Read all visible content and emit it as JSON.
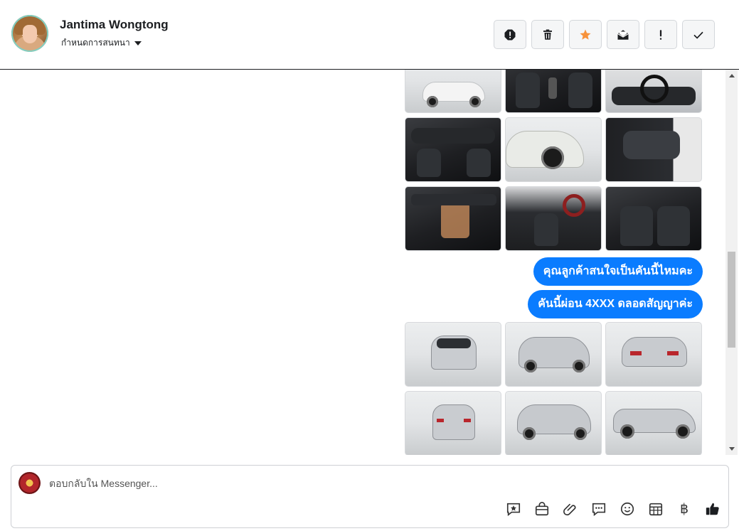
{
  "header": {
    "name": "Jantima Wongtong",
    "subtitle": "กำหนดการสนทนา",
    "actions": [
      {
        "name": "report-button",
        "icon": "alert-octagon-icon"
      },
      {
        "name": "delete-button",
        "icon": "trash-icon"
      },
      {
        "name": "star-button",
        "icon": "star-icon",
        "color": "#f7923b"
      },
      {
        "name": "mark-unread-button",
        "icon": "open-envelope-icon"
      },
      {
        "name": "important-button",
        "icon": "exclamation-icon"
      },
      {
        "name": "done-button",
        "icon": "check-icon"
      }
    ]
  },
  "chat": {
    "messages": [
      {
        "type": "images",
        "tiles": [
          "car-side-white",
          "interior-gear",
          "interior-wheel",
          "interior-dash",
          "car-front-white",
          "door-panel",
          "dashboard-console",
          "front-seats",
          "rear-seats"
        ]
      },
      {
        "type": "text",
        "text": "คุณลูกค้าสนใจเป็นคันนี้ไหมคะ"
      },
      {
        "type": "text",
        "text": "คันนี้ผ่อน 4XXX  ดลอดสัญญาค่ะ"
      },
      {
        "type": "images",
        "tiles": [
          "silver-front",
          "silver-front-34",
          "silver-rear-34",
          "silver-rear",
          "silver-rear-left",
          "silver-side"
        ]
      }
    ],
    "accent": "#0a7cff"
  },
  "composer": {
    "placeholder": "ตอบกลับใน Messenger...",
    "tools": [
      "saved-reply-icon",
      "shop-bag-icon",
      "paperclip-icon",
      "chat-bubble-icon",
      "emoji-icon",
      "table-icon",
      "baht-icon",
      "thumbs-up-icon"
    ],
    "baht_symbol": "฿"
  }
}
